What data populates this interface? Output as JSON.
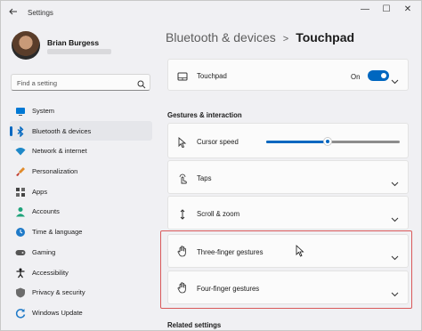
{
  "window": {
    "title": "Settings",
    "controls": [
      "—",
      "☐",
      "✕"
    ]
  },
  "profile": {
    "name": "Brian Burgess"
  },
  "search": {
    "placeholder": "Find a setting"
  },
  "nav": {
    "items": [
      {
        "label": "System",
        "icon": "system-icon",
        "active": false
      },
      {
        "label": "Bluetooth & devices",
        "icon": "bluetooth-icon",
        "active": true
      },
      {
        "label": "Network & internet",
        "icon": "wifi-icon",
        "active": false
      },
      {
        "label": "Personalization",
        "icon": "brush-icon",
        "active": false
      },
      {
        "label": "Apps",
        "icon": "apps-icon",
        "active": false
      },
      {
        "label": "Accounts",
        "icon": "person-icon",
        "active": false
      },
      {
        "label": "Time & language",
        "icon": "globe-clock-icon",
        "active": false
      },
      {
        "label": "Gaming",
        "icon": "gamepad-icon",
        "active": false
      },
      {
        "label": "Accessibility",
        "icon": "accessibility-icon",
        "active": false
      },
      {
        "label": "Privacy & security",
        "icon": "shield-icon",
        "active": false
      },
      {
        "label": "Windows Update",
        "icon": "update-icon",
        "active": false
      }
    ]
  },
  "breadcrumb": {
    "parent": "Bluetooth & devices",
    "separator": ">",
    "current": "Touchpad"
  },
  "touchpad": {
    "label": "Touchpad",
    "toggle_state": "On",
    "enabled": true
  },
  "gestures_section": {
    "title": "Gestures & interaction",
    "cursor_speed": {
      "label": "Cursor speed",
      "value_fraction": 0.46
    },
    "items": [
      {
        "label": "Taps",
        "icon": "tap-icon"
      },
      {
        "label": "Scroll & zoom",
        "icon": "scroll-icon"
      },
      {
        "label": "Three-finger gestures",
        "icon": "hand-icon"
      },
      {
        "label": "Four-finger gestures",
        "icon": "hand-icon"
      }
    ]
  },
  "related_section": {
    "title": "Related settings"
  },
  "colors": {
    "accent": "#0067c0",
    "highlight_border": "#d9595a"
  }
}
